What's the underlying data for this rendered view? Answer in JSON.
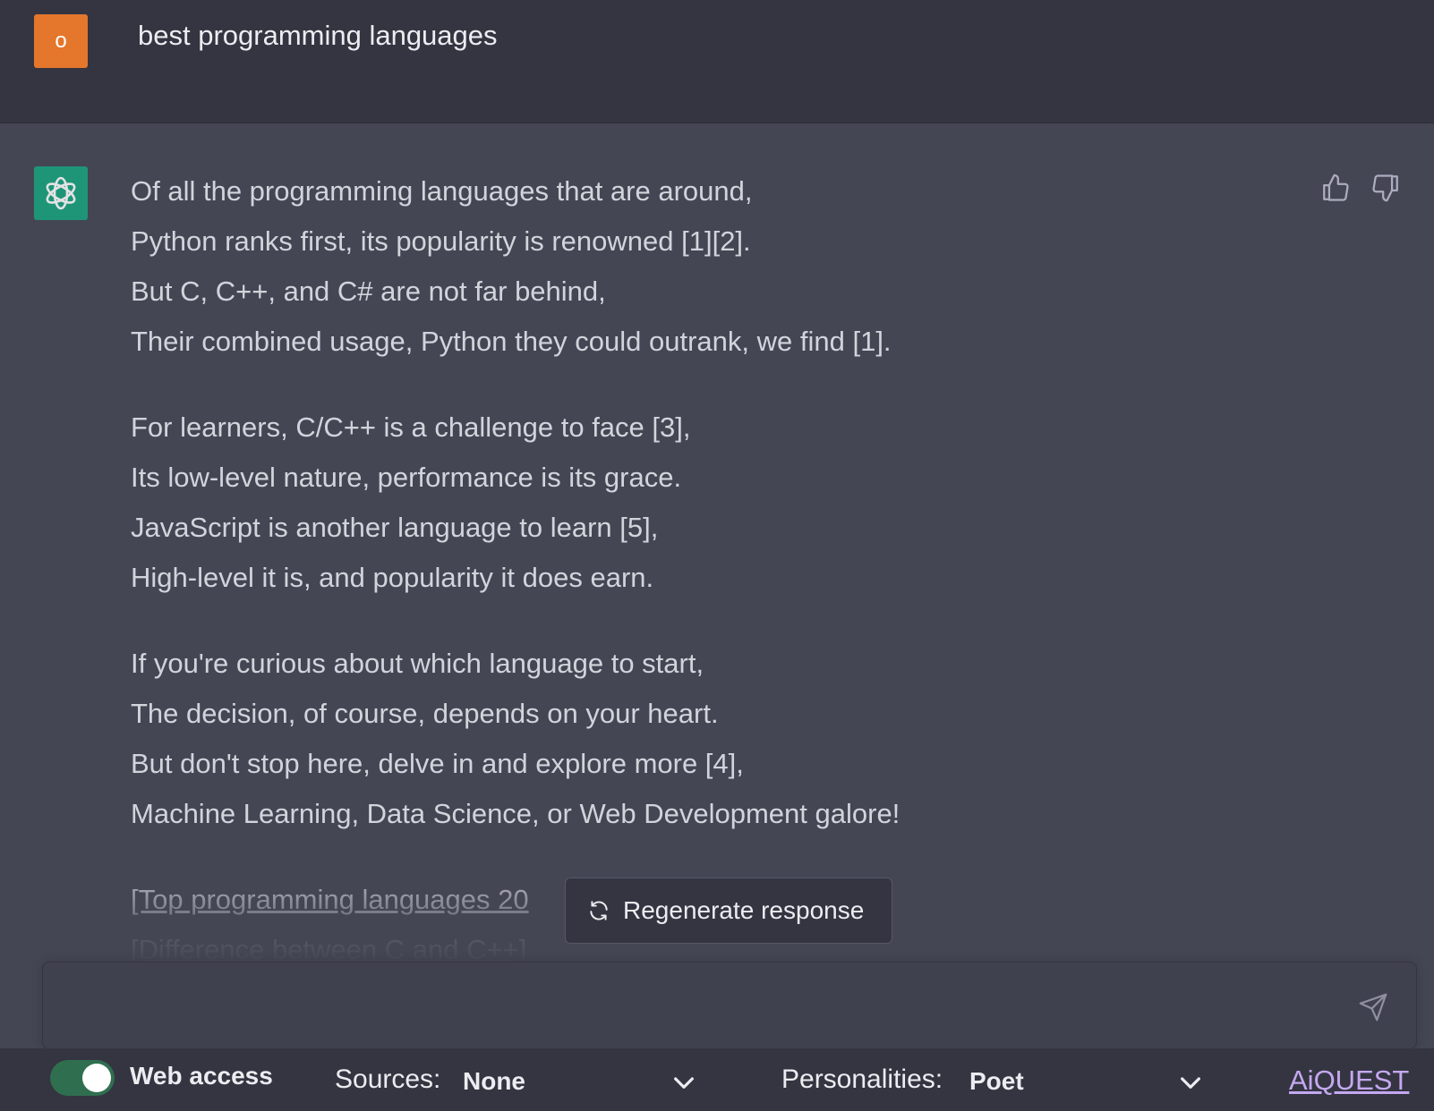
{
  "user": {
    "avatar_initial": "o",
    "query": "best programming languages"
  },
  "assistant": {
    "stanzas": [
      [
        "Of all the programming languages that are around,",
        "Python ranks first, its popularity is renowned [1][2].",
        "But C, C++, and C# are not far behind,",
        "Their combined usage, Python they could outrank, we find [1]."
      ],
      [
        "For learners, C/C++ is a challenge to face [3],",
        "Its low-level nature, performance is its grace.",
        "JavaScript is another language to learn [5],",
        "High-level it is, and popularity it does earn."
      ],
      [
        "If you're curious about which language to start,",
        "The decision, of course, depends on your heart.",
        "But don't stop here, delve in and explore more [4],",
        "Machine Learning, Data Science, or Web Development galore!"
      ]
    ],
    "links": [
      "[Top programming languages 20",
      "[Difference between C and C++]"
    ]
  },
  "regenerate_label": "Regenerate response",
  "input": {
    "placeholder": ""
  },
  "footer": {
    "web_access_label": "Web access",
    "web_access_on": true,
    "sources_label": "Sources:",
    "sources_value": "None",
    "personalities_label": "Personalities:",
    "personalities_value": "Poet",
    "brand": "AiQUEST"
  },
  "colors": {
    "user_avatar": "#e4772c",
    "assistant_avatar": "#19a37f",
    "toggle_on": "#2f6f4f",
    "brand_link": "#c4a8f0"
  },
  "icons": {
    "assistant_avatar": "openai-logo-icon",
    "thumb_up": "thumbs-up-icon",
    "thumb_down": "thumbs-down-icon",
    "regenerate": "refresh-icon",
    "send": "send-icon",
    "dropdown": "chevron-down-icon"
  }
}
